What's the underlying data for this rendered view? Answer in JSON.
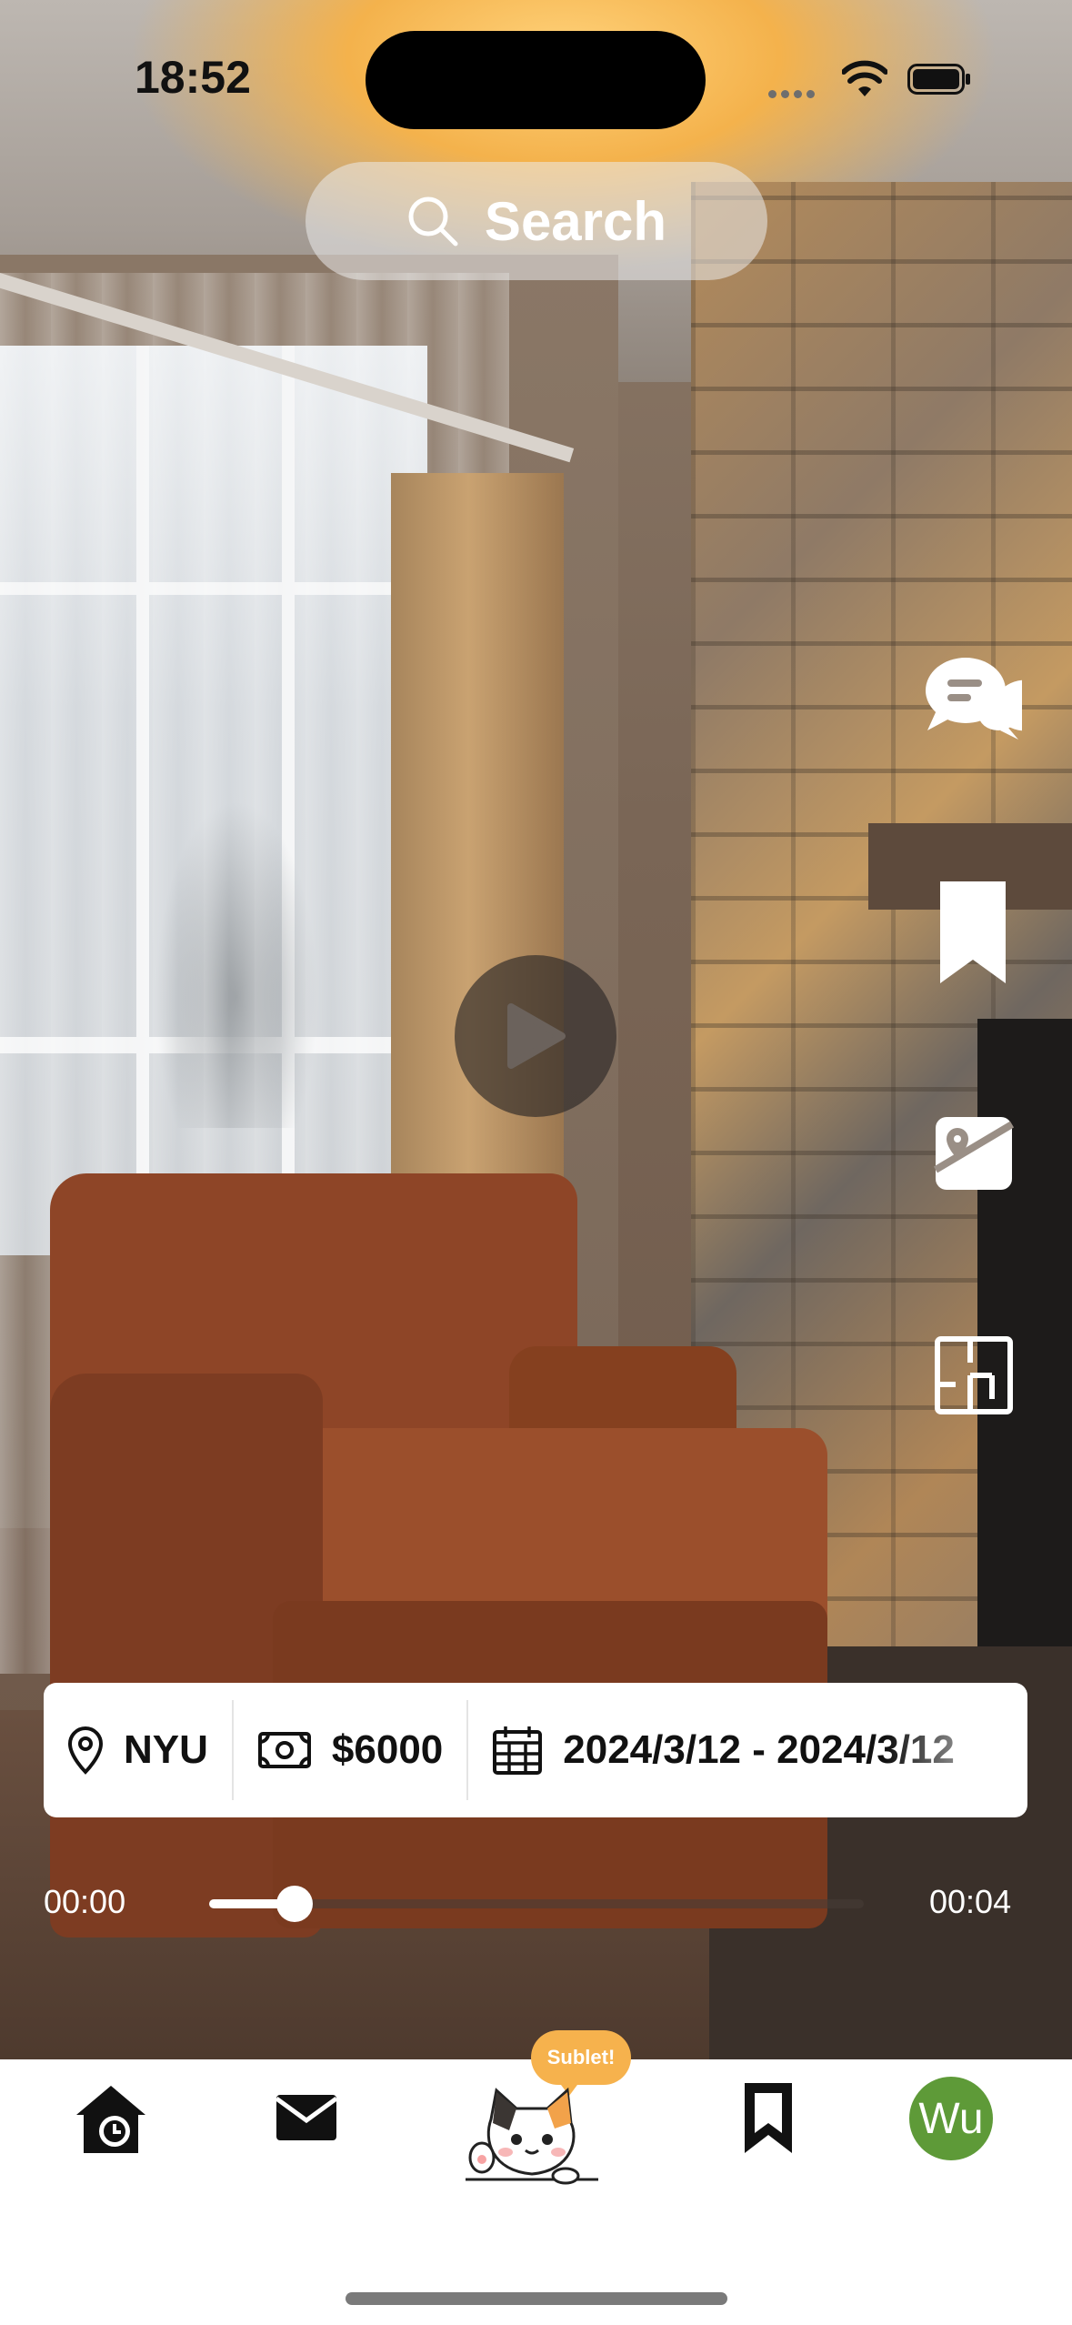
{
  "status_bar": {
    "time": "18:52"
  },
  "search": {
    "label": "Search"
  },
  "listing": {
    "location": "NYU",
    "price": "$6000",
    "dates": "2024/3/12 - 2024/3/12"
  },
  "player": {
    "current_time": "00:00",
    "duration": "00:04",
    "progress": 0.13
  },
  "right_actions": [
    "chat-icon",
    "bookmark-icon",
    "map-pin-icon",
    "floor-plan-icon"
  ],
  "tabbar": {
    "mascot_bubble": "Sublet!",
    "avatar_initials": "Wu",
    "items": [
      "home-clock-icon",
      "mail-icon",
      "cat-mascot-icon",
      "bookmark-icon",
      "avatar"
    ]
  },
  "colors": {
    "accent_orange": "#f6b24d",
    "avatar_green": "#5e9a38",
    "info_bar_bg": "#ffffff"
  }
}
